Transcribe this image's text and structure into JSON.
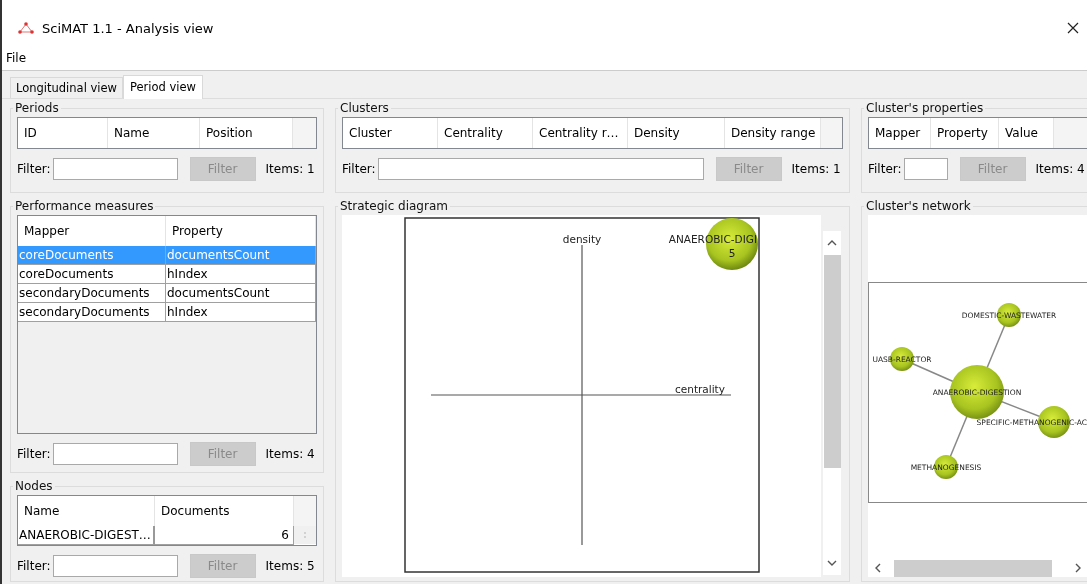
{
  "window": {
    "title": "SciMAT 1.1 - Analysis view"
  },
  "menu": [
    "File"
  ],
  "tabs": [
    {
      "label": "Longitudinal view",
      "selected": false
    },
    {
      "label": "Period view",
      "selected": true
    }
  ],
  "periods": {
    "title": "Periods",
    "columns": [
      "ID",
      "Name",
      "Position"
    ],
    "filter": {
      "label": "Filter:",
      "button": "Filter",
      "disabled": true,
      "items": "Items:  1"
    }
  },
  "performance_measures": {
    "title": "Performance measures",
    "columns": [
      "Mapper",
      "Property"
    ],
    "rows": [
      {
        "cells": [
          "coreDocuments",
          "documentsCount"
        ],
        "selected": true
      },
      {
        "cells": [
          "coreDocuments",
          "hIndex"
        ],
        "selected": false
      },
      {
        "cells": [
          "secondaryDocuments",
          "documentsCount"
        ],
        "selected": false
      },
      {
        "cells": [
          "secondaryDocuments",
          "hIndex"
        ],
        "selected": false
      }
    ],
    "filter": {
      "label": "Filter:",
      "button": "Filter",
      "disabled": true,
      "items": "Items:  4"
    }
  },
  "nodes": {
    "title": "Nodes",
    "columns": [
      "Name",
      "Documents"
    ],
    "rows": [
      {
        "cells": [
          "ANAEROBIC-DIGEST…",
          "6"
        ],
        "selected": false
      }
    ],
    "filter": {
      "label": "Filter:",
      "button": "Filter",
      "disabled": true,
      "items": "Items:  5"
    }
  },
  "clusters": {
    "title": "Clusters",
    "columns": [
      "Cluster",
      "Centrality",
      "Centrality r…",
      "Density",
      "Density range"
    ],
    "filter": {
      "label": "Filter:",
      "button": "Filter",
      "disabled": true,
      "items": "Items:  1"
    }
  },
  "strategic_diagram": {
    "title": "Strategic diagram",
    "y_axis": "density",
    "x_axis": "centrality",
    "clusters": [
      {
        "label": "ANAEROBIC-DIGI",
        "value": "5"
      }
    ]
  },
  "cluster_properties": {
    "title": "Cluster's properties",
    "columns": [
      "Mapper",
      "Property",
      "Value"
    ],
    "filter": {
      "label": "Filter:",
      "button": "Filter",
      "disabled": true,
      "items": "Items:  4"
    }
  },
  "cluster_network": {
    "title": "Cluster's network",
    "nodes": [
      {
        "label": "ANAEROBIC-DIGESTION"
      },
      {
        "label": "DOMESTIC-WASTEWATER"
      },
      {
        "label": "UASB-REACTOR"
      },
      {
        "label": "SPECIFIC-METHANOGENIC-AC"
      },
      {
        "label": "METHANOGENESIS"
      }
    ]
  }
}
